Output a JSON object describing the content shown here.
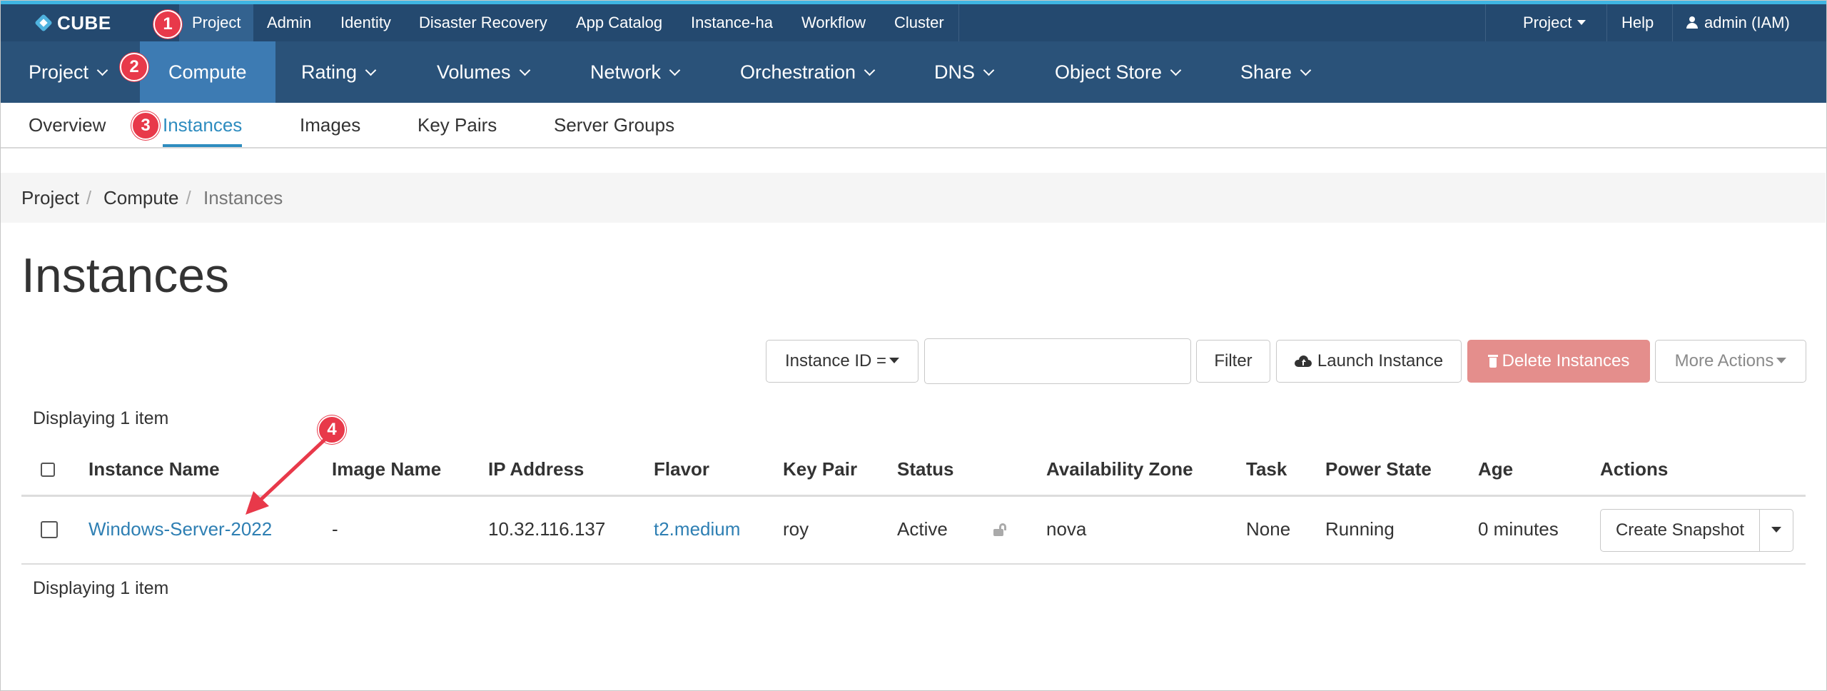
{
  "colors": {
    "topbar": "#24496f",
    "nav": "#2a5279",
    "nav_active": "#3d7bb3",
    "accent": "#3fb5e3",
    "link": "#2e7fb3",
    "danger": "#e48e8c",
    "annotation": "#e8394a"
  },
  "topbar": {
    "logo_text": "CUBE",
    "items": [
      "Project",
      "Admin",
      "Identity",
      "Disaster Recovery",
      "App Catalog",
      "Instance-ha",
      "Workflow",
      "Cluster"
    ],
    "right": {
      "project": "Project",
      "help": "Help",
      "user": "admin (IAM)"
    }
  },
  "nav": {
    "items": [
      "Project",
      "Compute",
      "Rating",
      "Volumes",
      "Network",
      "Orchestration",
      "DNS",
      "Object Store",
      "Share"
    ]
  },
  "subtabs": [
    "Overview",
    "Instances",
    "Images",
    "Key Pairs",
    "Server Groups"
  ],
  "breadcrumb": [
    "Project",
    "Compute",
    "Instances"
  ],
  "page_title": "Instances",
  "toolbar": {
    "filter_field": "Instance ID =",
    "filter_input": "",
    "filter_button": "Filter",
    "launch_button": "Launch Instance",
    "delete_button": "Delete Instances",
    "more_actions": "More Actions"
  },
  "table": {
    "count_text": "Displaying 1 item",
    "columns": [
      "Instance Name",
      "Image Name",
      "IP Address",
      "Flavor",
      "Key Pair",
      "Status",
      "Availability Zone",
      "Task",
      "Power State",
      "Age",
      "Actions"
    ],
    "rows": [
      {
        "name": "Windows-Server-2022",
        "image": "-",
        "ip": "10.32.116.137",
        "flavor": "t2.medium",
        "key_pair": "roy",
        "status": "Active",
        "zone": "nova",
        "task": "None",
        "power": "Running",
        "age": "0 minutes",
        "action": "Create Snapshot"
      }
    ],
    "footer_text": "Displaying 1 item"
  },
  "annotations": [
    "1",
    "2",
    "3",
    "4"
  ]
}
